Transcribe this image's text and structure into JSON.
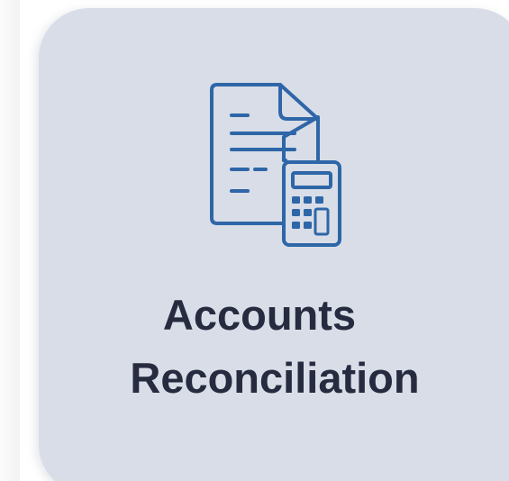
{
  "tile": {
    "title_line1": "Accounts",
    "title_line2": "Reconciliation",
    "icon": "document-calculator-icon"
  },
  "colors": {
    "card_background": "#d8dde7",
    "icon_stroke": "#2e66a8",
    "title_text": "#262b3f"
  }
}
